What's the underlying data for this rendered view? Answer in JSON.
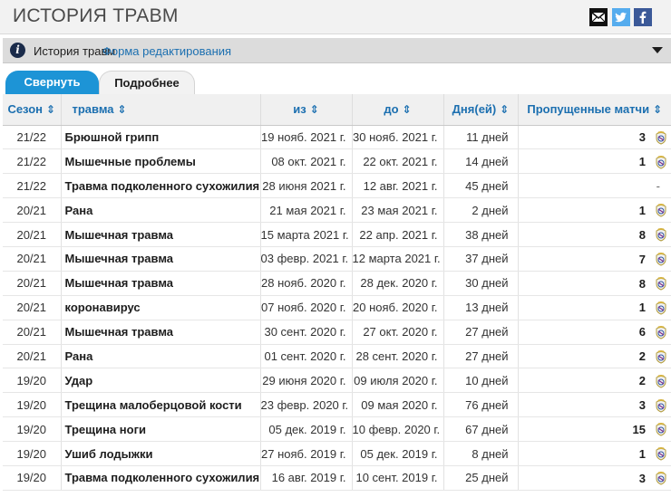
{
  "header": {
    "title": "ИСТОРИЯ ТРАВМ",
    "social": [
      "mail-icon",
      "twitter-icon",
      "facebook-icon"
    ]
  },
  "infobar": {
    "label": "История травм",
    "edit_link": "Форма редактирования"
  },
  "tabs": [
    {
      "label": "Свернуть",
      "active": true
    },
    {
      "label": "Подробнее",
      "active": false
    }
  ],
  "table": {
    "columns": [
      "Сезон",
      "травма",
      "из",
      "до",
      "Дня(ей)",
      "Пропущенные матчи"
    ],
    "rows": [
      {
        "season": "21/22",
        "injury": "Брюшной грипп",
        "from": "19 нояб. 2021 г.",
        "to": "30 нояб. 2021 г.",
        "days": "11 дней",
        "missed": "3"
      },
      {
        "season": "21/22",
        "injury": "Мышечные проблемы",
        "from": "08 окт. 2021 г.",
        "to": "22 окт. 2021 г.",
        "days": "14 дней",
        "missed": "1"
      },
      {
        "season": "21/22",
        "injury": "Травма подколенного сухожилия",
        "from": "28 июня 2021 г.",
        "to": "12 авг. 2021 г.",
        "days": "45 дней",
        "missed": "-"
      },
      {
        "season": "20/21",
        "injury": "Рана",
        "from": "21 мая 2021 г.",
        "to": "23 мая 2021 г.",
        "days": "2 дней",
        "missed": "1"
      },
      {
        "season": "20/21",
        "injury": "Мышечная травма",
        "from": "15 марта 2021 г.",
        "to": "22 апр. 2021 г.",
        "days": "38 дней",
        "missed": "8"
      },
      {
        "season": "20/21",
        "injury": "Мышечная травма",
        "from": "03 февр. 2021 г.",
        "to": "12 марта 2021 г.",
        "days": "37 дней",
        "missed": "7"
      },
      {
        "season": "20/21",
        "injury": "Мышечная травма",
        "from": "28 нояб. 2020 г.",
        "to": "28 дек. 2020 г.",
        "days": "30 дней",
        "missed": "8"
      },
      {
        "season": "20/21",
        "injury": "коронавирус",
        "from": "07 нояб. 2020 г.",
        "to": "20 нояб. 2020 г.",
        "days": "13 дней",
        "missed": "1"
      },
      {
        "season": "20/21",
        "injury": "Мышечная травма",
        "from": "30 сент. 2020 г.",
        "to": "27 окт. 2020 г.",
        "days": "27 дней",
        "missed": "6"
      },
      {
        "season": "20/21",
        "injury": "Рана",
        "from": "01 сент. 2020 г.",
        "to": "28 сент. 2020 г.",
        "days": "27 дней",
        "missed": "2"
      },
      {
        "season": "19/20",
        "injury": "Удар",
        "from": "29 июня 2020 г.",
        "to": "09 июля 2020 г.",
        "days": "10 дней",
        "missed": "2"
      },
      {
        "season": "19/20",
        "injury": "Трещина малоберцовой кости",
        "from": "23 февр. 2020 г.",
        "to": "09 мая 2020 г.",
        "days": "76 дней",
        "missed": "3"
      },
      {
        "season": "19/20",
        "injury": "Трещина ноги",
        "from": "05 дек. 2019 г.",
        "to": "10 февр. 2020 г.",
        "days": "67 дней",
        "missed": "15"
      },
      {
        "season": "19/20",
        "injury": "Ушиб лодыжки",
        "from": "27 нояб. 2019 г.",
        "to": "05 дек. 2019 г.",
        "days": "8 дней",
        "missed": "1"
      },
      {
        "season": "19/20",
        "injury": "Травма подколенного сухожилия",
        "from": "16 авг. 2019 г.",
        "to": "10 сент. 2019 г.",
        "days": "25 дней",
        "missed": "3"
      }
    ]
  },
  "colors": {
    "accent": "#1d94d6",
    "link": "#1b6fb0",
    "header_bg": "#f2f2f2"
  }
}
